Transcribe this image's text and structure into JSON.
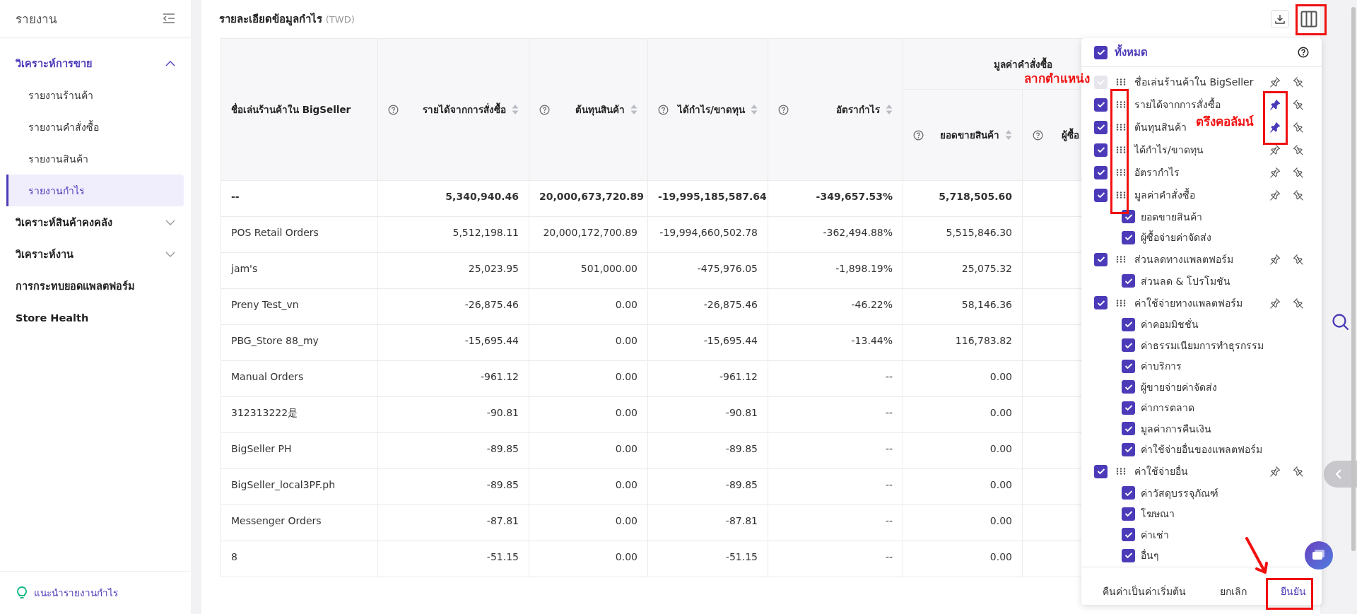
{
  "sidebar": {
    "title": "รายงาน",
    "items": [
      {
        "label": "วิเคราะห์การขาย",
        "expanded": true,
        "children": [
          {
            "label": "รายงานร้านค้า",
            "selected": false
          },
          {
            "label": "รายงานคำสั่งซื้อ",
            "selected": false
          },
          {
            "label": "รายงานสินค้า",
            "selected": false
          },
          {
            "label": "รายงานกำไร",
            "selected": true
          }
        ]
      },
      {
        "label": "วิเคราะห์สินค้าคงคลัง",
        "expanded": false
      },
      {
        "label": "วิเคราะห์งาน",
        "expanded": false
      },
      {
        "label": "การกระทบยอดแพลตฟอร์ม"
      },
      {
        "label": "Store Health"
      }
    ],
    "hint": "แนะนำรายงานกำไร"
  },
  "report": {
    "title": "รายละเอียดข้อมูลกำไร",
    "currency": "(TWD)",
    "columns": [
      {
        "label": "ชื่อเล่นร้านค้าใน BigSeller",
        "help": false,
        "sortable": false
      },
      {
        "label": "รายได้จากการสั่งซื้อ",
        "help": true,
        "sortable": true
      },
      {
        "label": "ต้นทุนสินค้า",
        "help": true,
        "sortable": true
      },
      {
        "label": "ได้กำไร/ขาดทุน",
        "help": true,
        "sortable": true
      },
      {
        "label": "อัตรากำไร",
        "help": true,
        "sortable": true
      }
    ],
    "column_group": {
      "label": "มูลค่าคำสั่งซื้อ",
      "columns": [
        {
          "label": "ยอดขายสินค้า",
          "help": true,
          "sortable": true
        },
        {
          "label": "ผู้ซื้อ",
          "help": true,
          "sortable": false
        }
      ]
    },
    "rows": [
      {
        "kind": "total",
        "cells": [
          "--",
          "5,340,940.46",
          "20,000,673,720.89",
          "-19,995,185,587.64",
          "-349,657.53%",
          "5,718,505.60"
        ]
      },
      {
        "kind": "store",
        "cells": [
          "POS Retail Orders",
          "5,512,198.11",
          "20,000,172,700.89",
          "-19,994,660,502.78",
          "-362,494.88%",
          "5,515,846.30"
        ]
      },
      {
        "kind": "store",
        "cells": [
          "jam's",
          "25,023.95",
          "501,000.00",
          "-475,976.05",
          "-1,898.19%",
          "25,075.32"
        ]
      },
      {
        "kind": "store",
        "cells": [
          "Preny Test_vn",
          "-26,875.46",
          "0.00",
          "-26,875.46",
          "-46.22%",
          "58,146.36"
        ]
      },
      {
        "kind": "store",
        "cells": [
          "PBG_Store 88_my",
          "-15,695.44",
          "0.00",
          "-15,695.44",
          "-13.44%",
          "116,783.82"
        ]
      },
      {
        "kind": "store",
        "cells": [
          "Manual Orders",
          "-961.12",
          "0.00",
          "-961.12",
          "--",
          "0.00"
        ]
      },
      {
        "kind": "store",
        "cells": [
          "312313222是",
          "-90.81",
          "0.00",
          "-90.81",
          "--",
          "0.00"
        ]
      },
      {
        "kind": "store",
        "cells": [
          "BigSeller PH",
          "-89.85",
          "0.00",
          "-89.85",
          "--",
          "0.00"
        ]
      },
      {
        "kind": "store",
        "cells": [
          "BigSeller_local3PF.ph",
          "-89.85",
          "0.00",
          "-89.85",
          "--",
          "0.00"
        ]
      },
      {
        "kind": "store",
        "cells": [
          "Messenger Orders",
          "-87.81",
          "0.00",
          "-87.81",
          "--",
          "0.00"
        ]
      },
      {
        "kind": "store",
        "cells": [
          "8",
          "-51.15",
          "0.00",
          "-51.15",
          "--",
          "0.00"
        ]
      }
    ]
  },
  "column_picker": {
    "all": {
      "label": "ทั้งหมด",
      "checked": true
    },
    "items": [
      {
        "label": "ชื่อเล่นร้านค้าใน BigSeller",
        "checked": true,
        "disabled": true,
        "pinned": false
      },
      {
        "label": "รายได้จากการสั่งซื้อ",
        "checked": true,
        "disabled": false,
        "pinned": true
      },
      {
        "label": "ต้นทุนสินค้า",
        "checked": true,
        "disabled": false,
        "pinned": true
      },
      {
        "label": "ได้กำไร/ขาดทุน",
        "checked": true,
        "disabled": false,
        "pinned": false
      },
      {
        "label": "อัตรากำไร",
        "checked": true,
        "disabled": false,
        "pinned": false
      },
      {
        "label": "มูลค่าคำสั่งซื้อ",
        "checked": true,
        "disabled": false,
        "pinned": false,
        "children": [
          {
            "label": "ยอดขายสินค้า",
            "checked": true
          },
          {
            "label": "ผู้ซื้อจ่ายค่าจัดส่ง",
            "checked": true
          }
        ]
      },
      {
        "label": "ส่วนลดทางแพลตฟอร์ม",
        "checked": true,
        "disabled": false,
        "pinned": false,
        "children": [
          {
            "label": "ส่วนลด & โปรโมชัน",
            "checked": true
          }
        ]
      },
      {
        "label": "ค่าใช้จ่ายทางแพลตฟอร์ม",
        "checked": true,
        "disabled": false,
        "pinned": false,
        "children": [
          {
            "label": "ค่าคอมมิชชั่น",
            "checked": true
          },
          {
            "label": "ค่าธรรมเนียมการทำธุรกรรม",
            "checked": true
          },
          {
            "label": "ค่าบริการ",
            "checked": true
          },
          {
            "label": "ผู้ขายจ่ายค่าจัดส่ง",
            "checked": true
          },
          {
            "label": "ค่าการตลาด",
            "checked": true
          },
          {
            "label": "มูลค่าการคืนเงิน",
            "checked": true
          },
          {
            "label": "ค่าใช้จ่ายอื่นของแพลตฟอร์ม",
            "checked": true
          }
        ]
      },
      {
        "label": "ค่าใช้จ่ายอื่น",
        "checked": true,
        "disabled": false,
        "pinned": false,
        "children": [
          {
            "label": "ค่าวัสดุบรรจุภัณฑ์",
            "checked": true
          },
          {
            "label": "โฆษณา",
            "checked": true
          },
          {
            "label": "ค่าเช่า",
            "checked": true
          },
          {
            "label": "อื่นๆ",
            "checked": true
          }
        ]
      }
    ],
    "buttons": [
      {
        "label": "คืนค่าเป็นค่าเริ่มต้น",
        "kind": "plain"
      },
      {
        "label": "ยกเลิก",
        "kind": "plain"
      },
      {
        "label": "ยืนยัน",
        "kind": "primary"
      }
    ]
  },
  "annotations": [
    {
      "text": "ลากตำแหน่ง"
    },
    {
      "text": "ตรึงคอลัมน์"
    }
  ]
}
